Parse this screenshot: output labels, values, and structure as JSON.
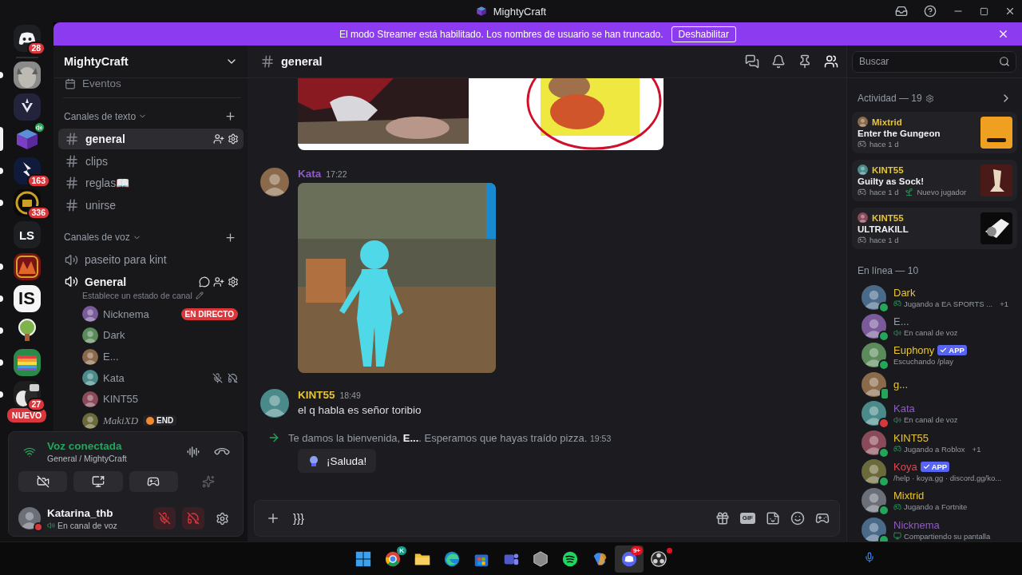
{
  "window": {
    "title": "MightyCraft"
  },
  "banner": {
    "text": "El modo Streamer está habilitado. Los nombres de usuario se han truncado.",
    "button": "Deshabilitar"
  },
  "servers": [
    {
      "kind": "home",
      "badge": "28",
      "selected": false,
      "unread": false,
      "voice": false
    },
    {
      "kind": "picture",
      "selected": false,
      "unread": true,
      "voice": false
    },
    {
      "kind": "picture",
      "selected": false,
      "unread": false,
      "voice": false
    },
    {
      "kind": "picture",
      "selected": true,
      "unread": false,
      "voice": true
    },
    {
      "kind": "picture",
      "badge": "163",
      "selected": false,
      "unread": true,
      "voice": false
    },
    {
      "kind": "picture",
      "badge": "336",
      "selected": false,
      "unread": true,
      "voice": false
    },
    {
      "kind": "text",
      "label": "LS",
      "selected": false,
      "unread": false,
      "voice": false
    },
    {
      "kind": "picture",
      "selected": false,
      "unread": true,
      "voice": false
    },
    {
      "kind": "wordmark",
      "label": "IS",
      "selected": false,
      "unread": true,
      "voice": false
    },
    {
      "kind": "picture",
      "selected": false,
      "unread": true,
      "voice": false
    },
    {
      "kind": "picture",
      "selected": false,
      "unread": true,
      "voice": false
    },
    {
      "kind": "picture",
      "badge": "27",
      "selected": false,
      "unread": true,
      "voice": false
    }
  ],
  "new_badge": "NUEVO",
  "sidebar": {
    "server_name": "MightyCraft",
    "events": "Eventos",
    "text_category": "Canales de texto",
    "text_channels": [
      {
        "name": "general",
        "selected": true
      },
      {
        "name": "clips",
        "selected": false
      },
      {
        "name": "reglas📖",
        "selected": false
      },
      {
        "name": "unirse",
        "selected": false
      }
    ],
    "voice_category": "Canales de voz",
    "voice_channels": [
      {
        "name": "paseito para kint",
        "connected": false
      },
      {
        "name": "General",
        "connected": true,
        "status_hint": "Establece un estado de canal",
        "members": [
          {
            "name": "Nicknema",
            "live": "EN DIRECTO",
            "muted": false,
            "deafened": false
          },
          {
            "name": "Dark",
            "muted": false,
            "deafened": false
          },
          {
            "name": "E...",
            "muted": false,
            "deafened": false
          },
          {
            "name": "Kata",
            "muted": true,
            "deafened": true
          },
          {
            "name": "KINT55",
            "muted": false,
            "deafened": false
          },
          {
            "name": "MakiXD",
            "tag": "END",
            "muted": false,
            "deafened": false
          }
        ]
      }
    ]
  },
  "voice_panel": {
    "status": "Voz conectada",
    "location": "General / MightyCraft",
    "actions": [
      {
        "kind": "camera",
        "disabled": false
      },
      {
        "kind": "screen",
        "disabled": false
      },
      {
        "kind": "activity",
        "disabled": false
      },
      {
        "kind": "soundboard",
        "disabled": true
      }
    ]
  },
  "user": {
    "name": "Katarina_thb",
    "status": "En canal de voz",
    "muted": true,
    "deafened": true
  },
  "chat": {
    "channel": "general",
    "members_panel_open": true,
    "messages": [
      {
        "kind": "attachment"
      },
      {
        "kind": "image_message",
        "author": "Kata",
        "color": "#8e5bc4",
        "time": "17:22"
      },
      {
        "kind": "text_message",
        "author": "KINT55",
        "color": "#e6c437",
        "time": "18:49",
        "text": "el q habla es señor toribio"
      },
      {
        "kind": "join",
        "text": "Te damos la bienvenida, **E...**. Esperamos que hayas traído pizza.",
        "time": "19:53",
        "button": "¡Saluda!"
      }
    ],
    "composer": {
      "value": "}}}",
      "gif_label": "GIF"
    }
  },
  "right_panel": {
    "search": {
      "placeholder": "Buscar"
    },
    "activity": {
      "title": "Actividad — 19",
      "cards": [
        {
          "user": "Mixtrid",
          "game": "Enter the Gungeon",
          "time": "hace 1 d"
        },
        {
          "user": "KINT55",
          "game": "Guilty as Sock!",
          "time": "hace 1 d",
          "tag": "Nuevo jugador"
        },
        {
          "user": "KINT55",
          "game": "ULTRAKILL",
          "time": "hace 1 d"
        }
      ]
    },
    "online": {
      "title": "En línea — 10",
      "members": [
        {
          "name": "Dark",
          "color": "#e6c437",
          "presence": {
            "color": "#23a55a",
            "mobile": false
          },
          "kind": "game",
          "activity": "Jugando a EA SPORTS ...",
          "extra": "+1"
        },
        {
          "name": "E...",
          "color": "#949ba4",
          "presence": {
            "color": "#23a55a",
            "mobile": false
          },
          "kind": "voice",
          "activity": "En canal de voz"
        },
        {
          "name": "Euphony",
          "color": "#e6c437",
          "presence": {
            "color": "#23a55a",
            "mobile": false
          },
          "app": "APP",
          "kind": "text",
          "activity": "Escuchando /play"
        },
        {
          "name": "g...",
          "color": "#e6c437",
          "presence": {
            "color": "#23a55a",
            "mobile": true
          },
          "kind": "none"
        },
        {
          "name": "Kata",
          "color": "#8e5bc4",
          "presence": {
            "color": "#da373c",
            "mobile": false
          },
          "kind": "voice",
          "activity": "En canal de voz"
        },
        {
          "name": "KINT55",
          "color": "#e6c437",
          "presence": {
            "color": "#23a55a",
            "mobile": false
          },
          "kind": "game",
          "activity": "Jugando a Roblox",
          "extra": "+1"
        },
        {
          "name": "Koya",
          "color": "#e0474d",
          "presence": {
            "color": "#23a55a",
            "mobile": false
          },
          "app": "APP",
          "kind": "text",
          "activity": "/help · koya.gg · discord.gg/ko..."
        },
        {
          "name": "Mixtrid",
          "color": "#e6c437",
          "presence": {
            "color": "#23a55a",
            "mobile": false
          },
          "kind": "game",
          "activity": "Jugando a Fortnite"
        },
        {
          "name": "Nicknema",
          "color": "#8e5bc4",
          "presence": {
            "color": "#23a55a",
            "mobile": false
          },
          "kind": "screen",
          "activity": "Compartiendo su pantalla"
        }
      ]
    }
  },
  "taskbar": {
    "apps": [
      {
        "kind": "windows",
        "selected": false,
        "alert": false
      },
      {
        "kind": "chrome",
        "badge": "K",
        "selected": false,
        "alert": false
      },
      {
        "kind": "files",
        "selected": false,
        "alert": false
      },
      {
        "kind": "edge",
        "selected": false,
        "alert": false
      },
      {
        "kind": "store",
        "selected": false,
        "alert": false
      },
      {
        "kind": "teams",
        "selected": false,
        "alert": false
      },
      {
        "kind": "hex",
        "selected": false,
        "alert": false
      },
      {
        "kind": "spotify",
        "selected": false,
        "alert": false
      },
      {
        "kind": "copilot",
        "selected": false,
        "alert": false
      },
      {
        "kind": "discord",
        "badge": "9+",
        "selected": true,
        "alert": false
      },
      {
        "kind": "obs",
        "selected": false,
        "alert": true
      }
    ]
  }
}
